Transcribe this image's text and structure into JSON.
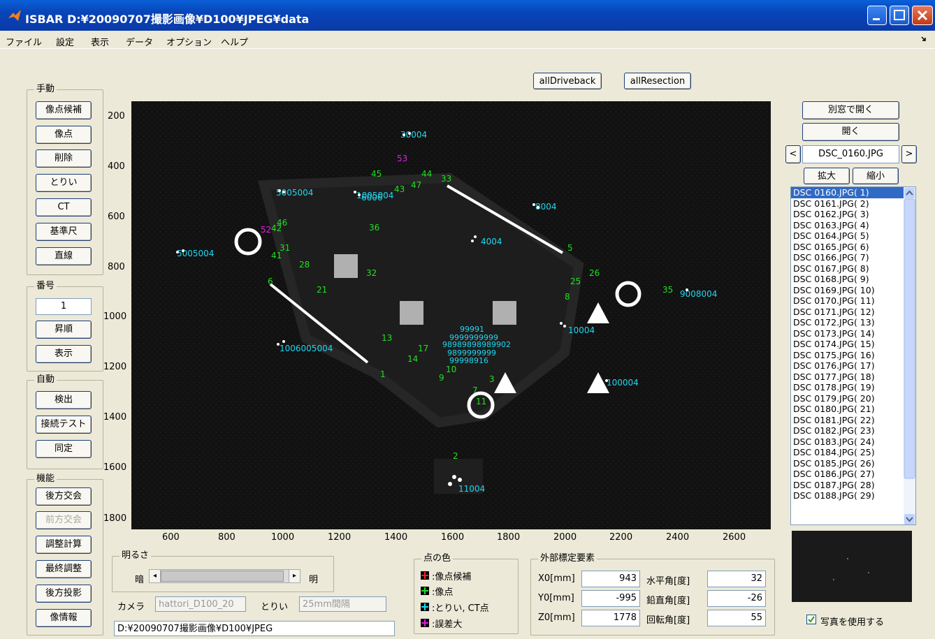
{
  "window": {
    "title": "ISBAR D:¥20090707撮影画像¥D100¥JPEG¥data"
  },
  "menu": [
    "ファイル",
    "設定",
    "表示",
    "データ",
    "オプション",
    "ヘルプ"
  ],
  "top_buttons": {
    "all_driveback": "allDriveback",
    "all_resection": "allResection"
  },
  "manual": {
    "label": "手動",
    "buttons": [
      "像点候補",
      "像点",
      "削除",
      "とりい",
      "CT",
      "基準尺",
      "直線"
    ]
  },
  "number": {
    "label": "番号",
    "value": "1",
    "buttons": [
      "昇順",
      "表示"
    ]
  },
  "auto": {
    "label": "自動",
    "buttons": [
      "検出",
      "接続テスト",
      "同定"
    ]
  },
  "functions": {
    "label": "機能",
    "buttons": [
      "後方交会",
      "前方交会",
      "調整計算",
      "最終調整",
      "後方投影",
      "像情報"
    ],
    "disabled_index": 1
  },
  "axes": {
    "y_ticks": [
      "200",
      "400",
      "600",
      "800",
      "1000",
      "1200",
      "1400",
      "1600",
      "1800"
    ],
    "x_ticks": [
      "600",
      "800",
      "1000",
      "1200",
      "1400",
      "1600",
      "1800",
      "2000",
      "2200",
      "2400",
      "2600"
    ]
  },
  "brightness": {
    "label": "明るさ",
    "dark": "暗",
    "bright": "明",
    "level": 0.92
  },
  "camera": {
    "label": "カメラ",
    "value": "hattori_D100_20",
    "torii_label": "とりい",
    "torii_value": "25mm間隔",
    "path": "D:¥20090707撮影画像¥D100¥JPEG"
  },
  "point_colors": {
    "label": "点の色",
    "items": [
      {
        "text": ":像点候補",
        "color": "#ff2020"
      },
      {
        "text": ":像点",
        "color": "#20e020"
      },
      {
        "text": ":とりい, CT点",
        "color": "#20d8f0"
      },
      {
        "text": ":誤差大",
        "color": "#e020e0"
      }
    ]
  },
  "exterior": {
    "label": "外部標定要素",
    "rows": [
      {
        "left_label": "X0[mm]",
        "left_value": "943",
        "right_label": "水平角[度]",
        "right_value": "32"
      },
      {
        "left_label": "Y0[mm]",
        "left_value": "-995",
        "right_label": "鉛直角[度]",
        "right_value": "-26"
      },
      {
        "left_label": "Z0[mm]",
        "left_value": "1778",
        "right_label": "回転角[度]",
        "right_value": "55"
      }
    ]
  },
  "right_panel": {
    "open_window": "別窓で開く",
    "open": "開く",
    "prev": "<",
    "next": ">",
    "current_file": "DSC_0160.JPG",
    "zoom_in": "拡大",
    "zoom_out": "縮小",
    "use_photo": "写真を使用する",
    "files": [
      "DSC 0160.JPG( 1)",
      "DSC 0161.JPG( 2)",
      "DSC 0162.JPG( 3)",
      "DSC 0163.JPG( 4)",
      "DSC 0164.JPG( 5)",
      "DSC 0165.JPG( 6)",
      "DSC 0166.JPG( 7)",
      "DSC 0167.JPG( 8)",
      "DSC 0168.JPG( 9)",
      "DSC 0169.JPG( 10)",
      "DSC 0170.JPG( 11)",
      "DSC 0171.JPG( 12)",
      "DSC 0172.JPG( 13)",
      "DSC 0173.JPG( 14)",
      "DSC 0174.JPG( 15)",
      "DSC 0175.JPG( 16)",
      "DSC 0176.JPG( 17)",
      "DSC 0177.JPG( 18)",
      "DSC 0178.JPG( 19)",
      "DSC 0179.JPG( 20)",
      "DSC 0180.JPG( 21)",
      "DSC 0181.JPG( 22)",
      "DSC 0182.JPG( 23)",
      "DSC 0183.JPG( 24)",
      "DSC 0184.JPG( 25)",
      "DSC 0185.JPG( 26)",
      "DSC 0186.JPG( 27)",
      "DSC 0187.JPG( 28)",
      "DSC 0188.JPG( 29)"
    ]
  },
  "plot_labels": {
    "cyan": [
      "30004",
      "1005004",
      "6006",
      "5005004",
      "5005004",
      "8004",
      "4004",
      "11004",
      "9008004",
      "10004",
      "1006005004",
      "100004"
    ],
    "green": [
      "33",
      "44",
      "45",
      "47",
      "43",
      "5",
      "25",
      "26",
      "8",
      "35",
      "21",
      "28",
      "32",
      "3",
      "2",
      "1",
      "17",
      "13",
      "14",
      "9",
      "10",
      "7",
      "11",
      "36",
      "41",
      "31",
      "6",
      "42",
      "46"
    ],
    "magenta": [
      "53",
      "52"
    ]
  },
  "colors": {
    "title_bar": "#0845b8",
    "plot_bg": "#101010",
    "cyan": "#20d8f0",
    "green": "#20e020",
    "magenta": "#e020e0",
    "select": "#316ac5"
  }
}
